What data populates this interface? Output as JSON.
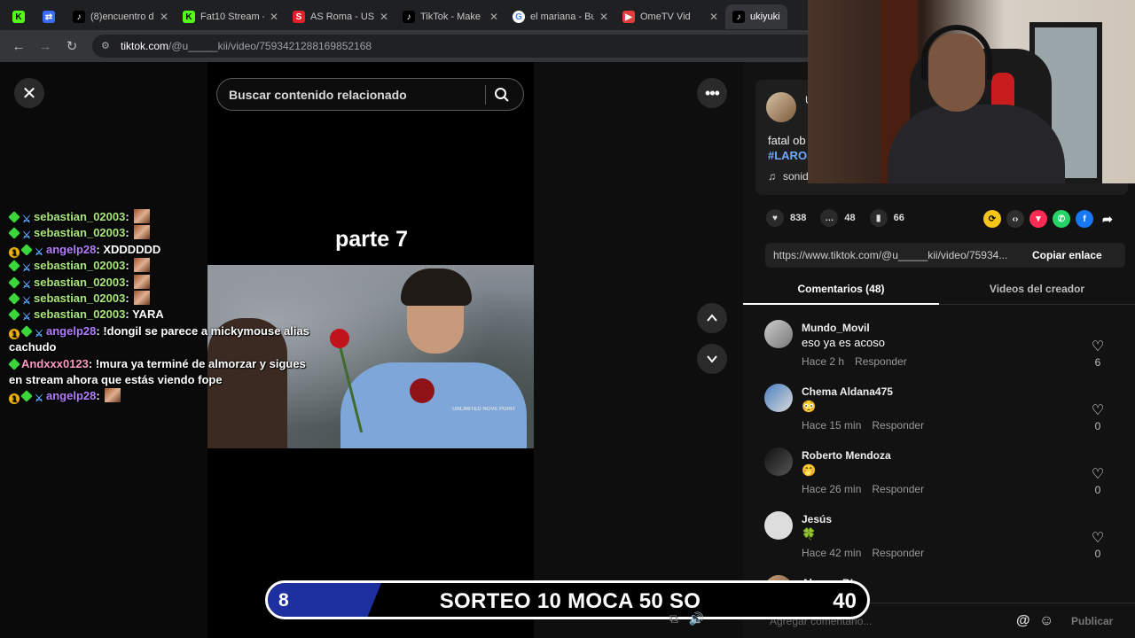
{
  "browser": {
    "tabs": [
      {
        "label": "",
        "icon": "kick",
        "active": false
      },
      {
        "label": "",
        "icon": "refresh-app",
        "active": false
      },
      {
        "label": "(8)encuentro d",
        "icon": "tiktok",
        "active": false
      },
      {
        "label": "Fat10 Stream -",
        "icon": "kick",
        "active": false
      },
      {
        "label": "AS Roma - US",
        "icon": "as-sports",
        "active": false
      },
      {
        "label": "TikTok - Make",
        "icon": "tiktok",
        "active": false
      },
      {
        "label": "el mariana - Bu",
        "icon": "google",
        "active": false
      },
      {
        "label": "OmeTV Vid",
        "icon": "ometv",
        "active": false
      },
      {
        "label": "ukiyuki",
        "icon": "tiktok",
        "active": true
      }
    ],
    "url_host": "tiktok.com",
    "url_path": "/@u_____kii/video/7593421288169852168"
  },
  "page": {
    "search_placeholder": "Buscar contenido relacionado",
    "video_caption": "parte 7",
    "video_watermark": "UNLIMITED NOVE POINT"
  },
  "chat": [
    {
      "badges": [
        "green",
        "sword"
      ],
      "user": "sebastian_02003",
      "color": "green",
      "msg": "",
      "emote": true
    },
    {
      "badges": [
        "green",
        "sword"
      ],
      "user": "sebastian_02003",
      "color": "green",
      "msg": "",
      "emote": true
    },
    {
      "badges": [
        "one",
        "green",
        "sword"
      ],
      "user": "angelp28",
      "color": "purple",
      "msg": "XDDDDDD",
      "emote": false
    },
    {
      "badges": [
        "green",
        "sword"
      ],
      "user": "sebastian_02003",
      "color": "green",
      "msg": "",
      "emote": true
    },
    {
      "badges": [
        "green",
        "sword"
      ],
      "user": "sebastian_02003",
      "color": "green",
      "msg": "",
      "emote": true
    },
    {
      "badges": [
        "green",
        "sword"
      ],
      "user": "sebastian_02003",
      "color": "green",
      "msg": "",
      "emote": true
    },
    {
      "badges": [
        "green",
        "sword"
      ],
      "user": "sebastian_02003",
      "color": "green",
      "msg": "YARA",
      "emote": false
    },
    {
      "badges": [
        "one",
        "green",
        "sword"
      ],
      "user": "angelp28",
      "color": "purple",
      "msg": "!dongil se parece a mickymouse alias cachudo",
      "emote": false
    },
    {
      "badges": [
        "green"
      ],
      "user": "Andxxx0123",
      "color": "pink",
      "msg": "!mura ya terminé de almorzar y sigues en stream ahora que estás viendo fope",
      "emote": false
    },
    {
      "badges": [
        "one",
        "green",
        "sword"
      ],
      "user": "angelp28",
      "color": "purple",
      "msg": "",
      "emote": true
    }
  ],
  "panel": {
    "author_initial": "U",
    "description": "fatal ob",
    "hashtag": "#LAROS",
    "sound": "sonid",
    "likes": "838",
    "comments_count": "48",
    "saves": "66",
    "share_link": "https://www.tiktok.com/@u_____kii/video/75934...",
    "copy_label": "Copiar enlace",
    "tab_comments": "Comentarios (48)",
    "tab_videos": "Videos del creador",
    "add_comment_placeholder": "Agregar comentario...",
    "at_symbol": "@",
    "publish_label": "Publicar"
  },
  "comments": [
    {
      "name": "Mundo_Movil",
      "text": "eso ya es acoso",
      "time": "Hace 2 h",
      "reply": "Responder",
      "likes": "6"
    },
    {
      "name": "Chema Aldana475",
      "text": "😳",
      "time": "Hace 15 min",
      "reply": "Responder",
      "likes": "0"
    },
    {
      "name": "Roberto Mendoza",
      "text": "🤭",
      "time": "Hace 26 min",
      "reply": "Responder",
      "likes": "0"
    },
    {
      "name": "Jesús",
      "text": "🍀",
      "time": "Hace 42 min",
      "reply": "Responder",
      "likes": "0"
    },
    {
      "name": "Alvarez BL",
      "text": "",
      "time": "",
      "reply": "",
      "likes": ""
    }
  ],
  "giveaway": {
    "left_number": "8",
    "text": "SORTEO 10 MOCA 50 SO",
    "right_number": "40"
  }
}
